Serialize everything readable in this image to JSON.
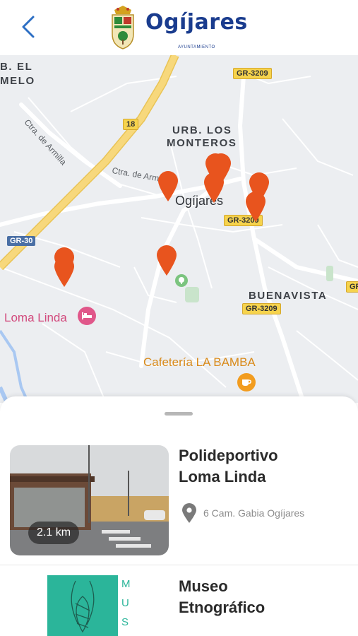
{
  "header": {
    "logo_text": "Ogíjares",
    "logo_sub": "AYUNTAMIENTO"
  },
  "map": {
    "area_labels": {
      "el_melo_a": "B. EL",
      "el_melo_b": "MELO",
      "los_monteros_a": "URB. LOS",
      "los_monteros_b": "MONTEROS",
      "buenavista": "BUENAVISTA",
      "ogijares": "Ogíjares"
    },
    "street_labels": {
      "ctra_armilla_1": "Ctra. de Armilla",
      "ctra_armilla_2": "Ctra. de Armilla"
    },
    "road_shields": {
      "gr3209_top": "GR-3209",
      "r18": "18",
      "gr3209_mid": "GR-3209",
      "gr30": "GR-30",
      "gr3209_low": "GR-3209",
      "gr_edge": "GR"
    },
    "poi": {
      "loma_linda": "Loma Linda",
      "cafeteria": "Cafetería LA BAMBA"
    },
    "colors": {
      "pin": "#e8541e",
      "highway": "#f7d87c",
      "poi_pink": "#e0578a",
      "poi_orange": "#f29c1f",
      "poi_green": "#7bc47f"
    }
  },
  "places": [
    {
      "title_line1": "Polideportivo",
      "title_line2": "Loma Linda",
      "address": "6 Cam. Gabia Ogíjares",
      "distance": "2.1 km"
    },
    {
      "title_line1": "Museo",
      "title_line2": "Etnográfico",
      "thumb_letters": [
        "M",
        "U",
        "S"
      ]
    }
  ]
}
